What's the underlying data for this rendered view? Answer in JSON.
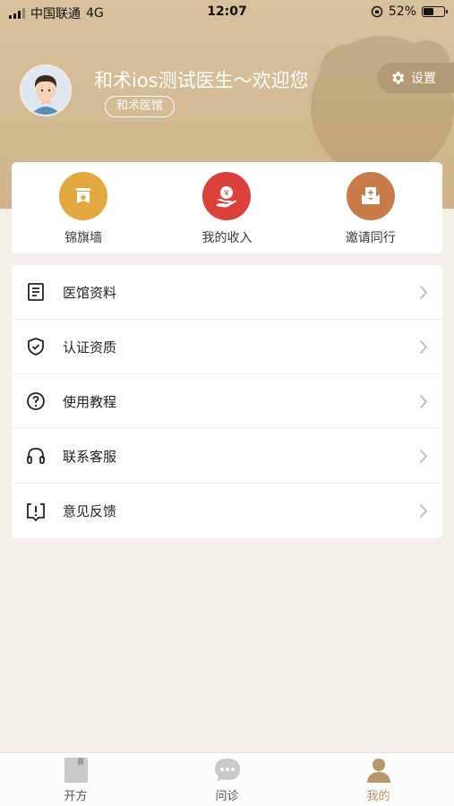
{
  "status_bar": {
    "carrier": "中国联通",
    "network": "4G",
    "time": "12:07",
    "battery_percent": "52%",
    "battery_level": 0.52
  },
  "profile": {
    "greeting": "和术ios测试医生～欢迎您",
    "clinic_tag": "和术医馆",
    "settings_label": "设置"
  },
  "quick_actions": [
    {
      "label": "锦旗墙",
      "icon": "banner-icon",
      "color": "#e2a93f"
    },
    {
      "label": "我的收入",
      "icon": "income-icon",
      "color": "#d9413a"
    },
    {
      "label": "邀请同行",
      "icon": "invite-icon",
      "color": "#c97c4a"
    }
  ],
  "menu": [
    {
      "label": "医馆资料",
      "icon": "document-icon"
    },
    {
      "label": "认证资质",
      "icon": "shield-check-icon"
    },
    {
      "label": "使用教程",
      "icon": "question-icon"
    },
    {
      "label": "联系客服",
      "icon": "headset-icon"
    },
    {
      "label": "意见反馈",
      "icon": "feedback-icon"
    }
  ],
  "tabs": [
    {
      "label": "开方",
      "icon": "bookmark-icon",
      "active": false
    },
    {
      "label": "问诊",
      "icon": "chat-icon",
      "active": false
    },
    {
      "label": "我的",
      "icon": "user-icon",
      "active": true
    }
  ],
  "colors": {
    "header": "#d4bb94",
    "accent": "#b9966a",
    "background": "#f2efe9"
  }
}
